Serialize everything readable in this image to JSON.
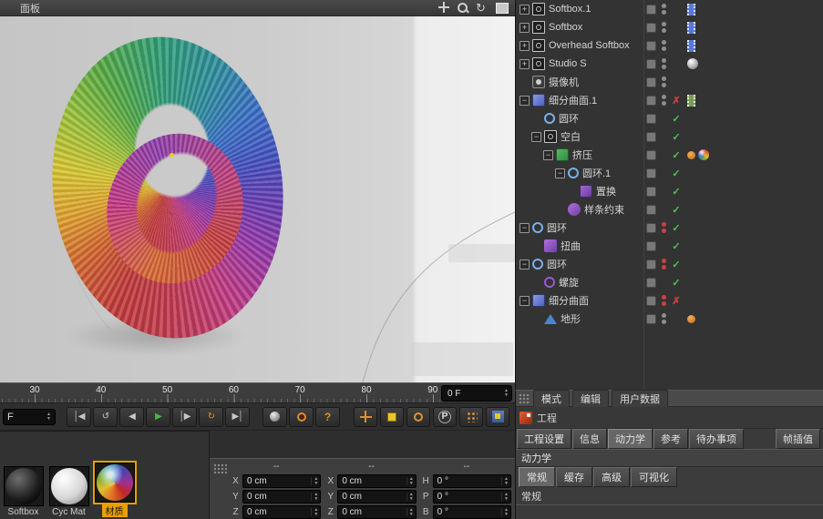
{
  "colors": {
    "accent_orange": "#e8a000",
    "check_green": "#4cc44c",
    "error_red": "#d04040",
    "play_green": "#49b649",
    "loop_orange": "#e08a2e"
  },
  "viewport": {
    "menu_items": [
      "面板"
    ],
    "nav_icons": [
      "pan",
      "zoom",
      "rotate",
      "maximize"
    ]
  },
  "object_manager": {
    "rows": [
      {
        "label": "Softbox.1",
        "depth": 0,
        "exp": "+",
        "icon": "softbox",
        "dots": "gray",
        "mark": "",
        "tags": [
          "film-blue"
        ]
      },
      {
        "label": "Softbox",
        "depth": 0,
        "exp": "+",
        "icon": "softbox",
        "dots": "gray",
        "mark": "",
        "tags": [
          "film-blue"
        ]
      },
      {
        "label": "Overhead Softbox",
        "depth": 0,
        "exp": "+",
        "icon": "softbox",
        "dots": "gray",
        "mark": "",
        "tags": [
          "film-blue"
        ]
      },
      {
        "label": "Studio S",
        "depth": 0,
        "exp": "+",
        "icon": "softbox",
        "dots": "gray",
        "mark": "",
        "tags": [
          "sphere-gray"
        ]
      },
      {
        "label": "摄像机",
        "depth": 0,
        "exp": "",
        "icon": "camera",
        "dots": "gray",
        "mark": "",
        "tags": []
      },
      {
        "label": "细分曲面.1",
        "depth": 0,
        "exp": "-",
        "icon": "subd",
        "dots": "gray",
        "mark": "x",
        "tags": [
          "film-green"
        ]
      },
      {
        "label": "圆环",
        "depth": 1,
        "exp": "",
        "icon": "circle",
        "dots": "",
        "mark": "check",
        "tags": []
      },
      {
        "label": "空白",
        "depth": 1,
        "exp": "-",
        "icon": "null",
        "dots": "",
        "mark": "check",
        "tags": []
      },
      {
        "label": "挤压",
        "depth": 2,
        "exp": "-",
        "icon": "extrude",
        "dots": "",
        "mark": "check",
        "tags": [
          "dot-orange",
          "sphere-rainbow"
        ]
      },
      {
        "label": "圆环.1",
        "depth": 3,
        "exp": "-",
        "icon": "circle",
        "dots": "",
        "mark": "check",
        "tags": []
      },
      {
        "label": "置换",
        "depth": 4,
        "exp": "",
        "icon": "displace",
        "dots": "",
        "mark": "check",
        "tags": []
      },
      {
        "label": "样条约束",
        "depth": 3,
        "exp": "",
        "icon": "splinecon",
        "dots": "",
        "mark": "check",
        "tags": []
      },
      {
        "label": "圆环",
        "depth": 0,
        "exp": "-",
        "icon": "circle",
        "dots": "red",
        "mark": "check",
        "tags": []
      },
      {
        "label": "扭曲",
        "depth": 1,
        "exp": "",
        "icon": "bend",
        "dots": "",
        "mark": "check",
        "tags": []
      },
      {
        "label": "圆环",
        "depth": 0,
        "exp": "-",
        "icon": "circle",
        "dots": "red",
        "mark": "check",
        "tags": []
      },
      {
        "label": "螺旋",
        "depth": 1,
        "exp": "",
        "icon": "spiral",
        "dots": "",
        "mark": "check",
        "tags": []
      },
      {
        "label": "细分曲面",
        "depth": 0,
        "exp": "-",
        "icon": "subd",
        "dots": "red",
        "mark": "x",
        "tags": []
      },
      {
        "label": "地形",
        "depth": 1,
        "exp": "",
        "icon": "landscape",
        "dots": "gray",
        "mark": "",
        "tags": [
          "dot-orange"
        ]
      }
    ]
  },
  "timeline": {
    "ticks": [
      "30",
      "40",
      "50",
      "60",
      "70",
      "80",
      "90"
    ],
    "frame_value": "0 F"
  },
  "transport": {
    "frame_dropdown": "F",
    "buttons": [
      {
        "name": "goto-start",
        "glyph": "│◀"
      },
      {
        "name": "play-backward",
        "glyph": "↺"
      },
      {
        "name": "prev-frame",
        "glyph": "◀"
      },
      {
        "name": "play",
        "glyph": "▶",
        "color": "#49b649"
      },
      {
        "name": "next-frame",
        "glyph": "│▶"
      },
      {
        "name": "loop",
        "glyph": "↻",
        "color": "#e08a2e"
      },
      {
        "name": "goto-end",
        "glyph": "▶│"
      }
    ],
    "render_buttons": [
      {
        "name": "render-view"
      },
      {
        "name": "render-settings"
      },
      {
        "name": "help",
        "glyph": "?"
      }
    ],
    "tool_buttons": [
      {
        "name": "move-tool"
      },
      {
        "name": "scale-tool"
      },
      {
        "name": "rotate-tool"
      },
      {
        "name": "coordinate-system",
        "glyph": "P"
      },
      {
        "name": "snap-grid"
      },
      {
        "name": "workplane"
      }
    ]
  },
  "materials": {
    "items": [
      {
        "name": "Softbox",
        "variant": "black",
        "selected": false
      },
      {
        "name": "Cyc Mat",
        "variant": "white",
        "selected": false
      },
      {
        "name": "材质",
        "variant": "rainbow",
        "selected": true
      }
    ]
  },
  "coordinates": {
    "groups": [
      {
        "name": "position",
        "header": "--",
        "rows": [
          {
            "label": "X",
            "value": "0 cm"
          },
          {
            "label": "Y",
            "value": "0 cm"
          },
          {
            "label": "Z",
            "value": "0 cm"
          }
        ]
      },
      {
        "name": "size",
        "header": "--",
        "rows": [
          {
            "label": "X",
            "value": "0 cm"
          },
          {
            "label": "Y",
            "value": "0 cm"
          },
          {
            "label": "Z",
            "value": "0 cm"
          }
        ]
      },
      {
        "name": "rotation",
        "header": "--",
        "rows": [
          {
            "label": "H",
            "value": "0 °"
          },
          {
            "label": "P",
            "value": "0 °"
          },
          {
            "label": "B",
            "value": "0 °"
          }
        ]
      }
    ]
  },
  "attributes": {
    "mode_tabs": [
      "模式",
      "编辑",
      "用户数据"
    ],
    "project_label": "工程",
    "tabs": [
      {
        "label": "工程设置",
        "active": false,
        "right": false
      },
      {
        "label": "信息",
        "active": false,
        "right": false
      },
      {
        "label": "动力学",
        "active": true,
        "right": false
      },
      {
        "label": "参考",
        "active": false,
        "right": false
      },
      {
        "label": "待办事项",
        "active": false,
        "right": false
      },
      {
        "label": "帧插值",
        "active": false,
        "right": true
      }
    ],
    "section_title": "动力学",
    "sub_tabs": [
      {
        "label": "常规",
        "active": true
      },
      {
        "label": "缓存",
        "active": false
      },
      {
        "label": "高级",
        "active": false
      },
      {
        "label": "可视化",
        "active": false
      }
    ],
    "subsection_title": "常规"
  }
}
